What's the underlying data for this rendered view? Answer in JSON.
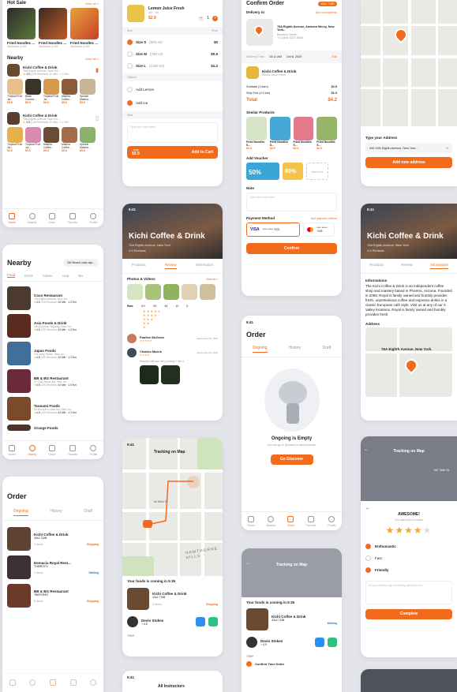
{
  "colors": {
    "accent": "#f26b1d",
    "star": "#f6a623"
  },
  "home": {
    "hot_sale_title": "Hot Sale",
    "view_all": "View all »",
    "hot_items": [
      {
        "name": "Fried Noodles ...",
        "sub": "Starbucks & Kit"
      },
      {
        "name": "Fried Noodles ...",
        "sub": "Starbucks & Kit"
      },
      {
        "name": "Fried Noodles ...",
        "sub": "Starbucks & Kit"
      }
    ],
    "nearby_title": "Nearby",
    "shops": [
      {
        "name": "Kichi Coffee & Drink",
        "addr": "76A Eighth Avenue, New Yor...",
        "rating": "4.5",
        "reviews": "(125 Reviews)",
        "time": "10 Min · 1.2 Km",
        "products": [
          {
            "n": "Tropical Fruit Jui...",
            "p": "$5.6"
          },
          {
            "n": "Black Current...",
            "p": "$5.6"
          },
          {
            "n": "Tropical Fruit Jui...",
            "p": "$5.6"
          },
          {
            "n": "Matcha Coffee...",
            "p": "$5.6"
          },
          {
            "n": "Special Matcha...",
            "p": "$5.6"
          }
        ]
      },
      {
        "name": "Kichi Coffee & Drink",
        "addr": "76A Eighth Avenue, New Yor...",
        "rating": "4.5",
        "reviews": "(125 Reviews)",
        "time": "10 Min · 1.2 Km",
        "products": [
          {
            "n": "Tropical Fruit Jui...",
            "p": "$5.6"
          },
          {
            "n": "Tropical Fruit Jui...",
            "p": "$5.6"
          },
          {
            "n": "Matcha Coffee...",
            "p": "$5.6"
          },
          {
            "n": "Matcha Coffee...",
            "p": "$5.6"
          },
          {
            "n": "Special Matcha...",
            "p": "$5.6"
          }
        ]
      }
    ]
  },
  "tabs": {
    "home": "Home",
    "nearby": "Nearby",
    "order": "Order",
    "favorite": "Favorite",
    "profile": "Profile"
  },
  "product": {
    "name": "Lemon Juice Fresh",
    "meta": "18+  ·  55",
    "price": "$2.9",
    "qty": "1",
    "size_label": "Size",
    "price_label": "Price",
    "sizes": [
      {
        "n": "Size S",
        "v": "(500 ml)",
        "p": "$0"
      },
      {
        "n": "Size M",
        "v": "(750 ml)",
        "p": "$0.5"
      },
      {
        "n": "Size L",
        "v": "(1000 ml)",
        "p": "$1.2"
      }
    ],
    "options_label": "Options",
    "options": [
      "Add Lemon",
      "Add Ice"
    ],
    "note_label": "Note",
    "note_placeholder": "Type your note here!",
    "total_label": "Total",
    "total": "$2.9",
    "add_cart": "Add to Cart"
  },
  "confirm": {
    "title": "Confirm Order",
    "cart_badge": "43x1 7188",
    "delivery_to": "Delivery to",
    "add_address": "Add new address",
    "address": "76A Eighth Avenue, Andorra Mercy, New York...",
    "receiver": "Beatrice Green",
    "phone": "+1 (484) 3421 8693",
    "delivery_time_label": "Delivery Time",
    "delivery_time": "10:11 AM",
    "delivery_date": "Oct 6, 2020",
    "edit": "Edit",
    "item_name": "Kichi Coffee & Drink",
    "item_sub": "Lemon Juice Fresh",
    "subtotal_label": "Subtotal (1 item)",
    "subtotal": "$2.9",
    "ship_label": "Ship Fee (2.4 km)",
    "ship": "$1.3",
    "total_label": "Total",
    "total": "$4.2",
    "similar_title": "Similar Products",
    "similar": [
      {
        "n": "Fried Noodles S...",
        "p": "$2.9"
      },
      {
        "n": "Fried Noodles S...",
        "p": "$2.9"
      },
      {
        "n": "Fried Noodles S...",
        "p": "$2.9"
      },
      {
        "n": "Fried Noodles S...",
        "p": "$2.9"
      }
    ],
    "voucher_title": "Add Voucher",
    "voucher_a": "50%",
    "voucher_b": "80%",
    "voucher_add": "Add more",
    "note_title": "Note",
    "note_placeholder": "Type your note here!",
    "payment_title": "Payment Method",
    "payment_add": "Add payment method",
    "card_number": "**** ***** *325",
    "confirm_btn": "Confirm"
  },
  "address_screen": {
    "type_label": "Type your Address",
    "value": "330 15th Eighth Avenue, New York...",
    "add_btn": "Add new address"
  },
  "nearby_screen": {
    "title": "Nearby",
    "location": "330 Broad Lucks Apt...",
    "filters": [
      "Food",
      "Drink",
      "Cakes",
      "Asia",
      "Ba"
    ],
    "list": [
      {
        "n": "Coco Restaurant",
        "a": "76A Eighth Avenue, New Yor...",
        "r": "4.5",
        "rc": "(125 Reviews)",
        "t": "10 Min · 1.2 Km"
      },
      {
        "n": "Asia Foods & Drink",
        "a": "350 Brooklyn Highway, New Yor...",
        "r": "4.5",
        "rc": "(125 Reviews)",
        "t": "10 Min · 1.2 Km"
      },
      {
        "n": "Japan Foods",
        "a": "124 Andy Haven, New Yor...",
        "r": "4.5",
        "rc": "(125 Reviews)",
        "t": "10 Min · 1.2 Km"
      },
      {
        "n": "BB & BG Restaurant",
        "a": "97 Colin Burgs Apt, New Yor...",
        "r": "4.5",
        "rc": "(125 Reviews)",
        "t": "10 Min · 1.5 Km"
      },
      {
        "n": "Tsunami Foods",
        "a": "80 McLaren Locks Apt, New Yor...",
        "r": "4.5",
        "rc": "(125 Reviews)",
        "t": "10 Min · 1.2 Km"
      },
      {
        "n": "Orange Foods",
        "a": "",
        "r": "",
        "rc": "",
        "t": ""
      }
    ]
  },
  "detail": {
    "clock": "9:41",
    "name": "Kichi Coffee & Drink",
    "address": "76A Eighth Avenue, New York",
    "meta": "4.5 Reviews",
    "tabs": [
      "Products",
      "Review",
      "Information"
    ],
    "photos_title": "Photos & Videos",
    "view_all": "View all »",
    "rate_label": "Rate",
    "rate_cols": [
      "10+",
      "50",
      "45",
      "12",
      "5"
    ],
    "reviewers": [
      {
        "n": "Pauline McGuire",
        "d": "September 30, 2020",
        "c": ""
      },
      {
        "n": "Charles Morris",
        "d": "September 29, 2020",
        "c": "Matcha milk tea very yummy! i like it."
      }
    ]
  },
  "info_screen": {
    "info_title": "Informations",
    "info_text": "The Kichi Coffee & Drink is an independent coffee shop and roastery based in Phoenix, Arizona. Founded in 2008, Royal is family owned and humbly provides fresh, unpretentious coffee and espresso drinks in a classic European café style. Visit us at any of our 3 Valley locations. Royal is family owned and humbly provides fresh.",
    "address_title": "Address",
    "address": "76A Eighth Avenue, New York."
  },
  "order_screen": {
    "clock": "9:41",
    "title": "Order",
    "tabs": [
      "Ongoing",
      "History",
      "Draft"
    ],
    "empty_title": "Ongoing is Empty",
    "empty_sub": "You can go to Discover to add products.",
    "discover_btn": "Go Discover"
  },
  "order_list": {
    "title": "Order",
    "tabs": [
      "Ongoing",
      "History",
      "Draft"
    ],
    "items": [
      {
        "n": "Kichi Coffee & Drink",
        "c": "43x2 7188",
        "q": "3 Items",
        "s": "Shipping"
      },
      {
        "n": "Demacia Royal Rest...",
        "c": "TH8RES74",
        "q": "1 Items",
        "s": "Waiting"
      },
      {
        "n": "BB & BG Restaurant",
        "c": "T8EFKR9H",
        "q": "5 Items",
        "s": "Shipping"
      }
    ]
  },
  "tracking": {
    "clock": "9:41",
    "title": "Tracking on Map",
    "coming": "Your foods is coming in 5:35",
    "shop": "Kichi Coffee & Drink",
    "code": "43x2 7188",
    "items": "4 Items",
    "status": "Shipping",
    "driver": "Devin Stokes",
    "driver_rating": "4.5",
    "trip_label": "TRIP",
    "street_a": "W 50th St",
    "hills": "HAWTHORNE HILLS",
    "street_b": "NE 78th St"
  },
  "tracking2": {
    "title": "Tracking on Map",
    "coming": "Your foods is coming in 5:35",
    "shop": "Kichi Coffee & Drink",
    "code": "43x2 7188",
    "status": "Waiting",
    "driver": "Devin Stokes",
    "driver_rating": "4.5",
    "trip_label": "TRIP",
    "step": "Confirm Your Order"
  },
  "rating": {
    "title": "AWESOME!",
    "sub": "You rated Devin 4 stars",
    "tags": [
      "Enthusiastic",
      "Fast",
      "Friendly"
    ],
    "comment_placeholder": "Do you want to say something about Devin?",
    "complete_btn": "Complete"
  },
  "bottom": {
    "clock": "9:41",
    "instructor": "All Instructors"
  }
}
